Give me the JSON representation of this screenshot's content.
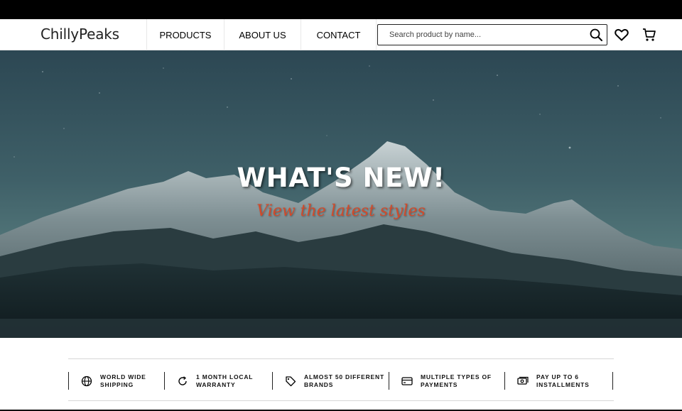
{
  "brand": {
    "logo_text": "ChillyPeaks"
  },
  "nav": {
    "links": [
      {
        "label": "PRODUCTS"
      },
      {
        "label": "ABOUT US"
      },
      {
        "label": "CONTACT"
      }
    ]
  },
  "search": {
    "placeholder": "Search product by name...",
    "value": ""
  },
  "header_icons": {
    "search": "search-icon",
    "wishlist": "heart-icon",
    "cart": "cart-icon"
  },
  "hero": {
    "title": "WHAT'S NEW!",
    "subtitle": "View the latest styles",
    "accent_color": "#d24a2a"
  },
  "features": [
    {
      "icon": "globe-icon",
      "line1": "WORLD WIDE",
      "line2": "SHIPPING"
    },
    {
      "icon": "refresh-icon",
      "line1": "1 MONTH LOCAL",
      "line2": "WARRANTY"
    },
    {
      "icon": "tag-icon",
      "line1": "ALMOST 50 DIFFERENT",
      "line2": "BRANDS"
    },
    {
      "icon": "credit-card-icon",
      "line1": "MULTIPLE TYPES OF",
      "line2": "PAYMENTS"
    },
    {
      "icon": "cash-icon",
      "line1": "PAY UP TO 6",
      "line2": "INSTALLMENTS"
    }
  ]
}
